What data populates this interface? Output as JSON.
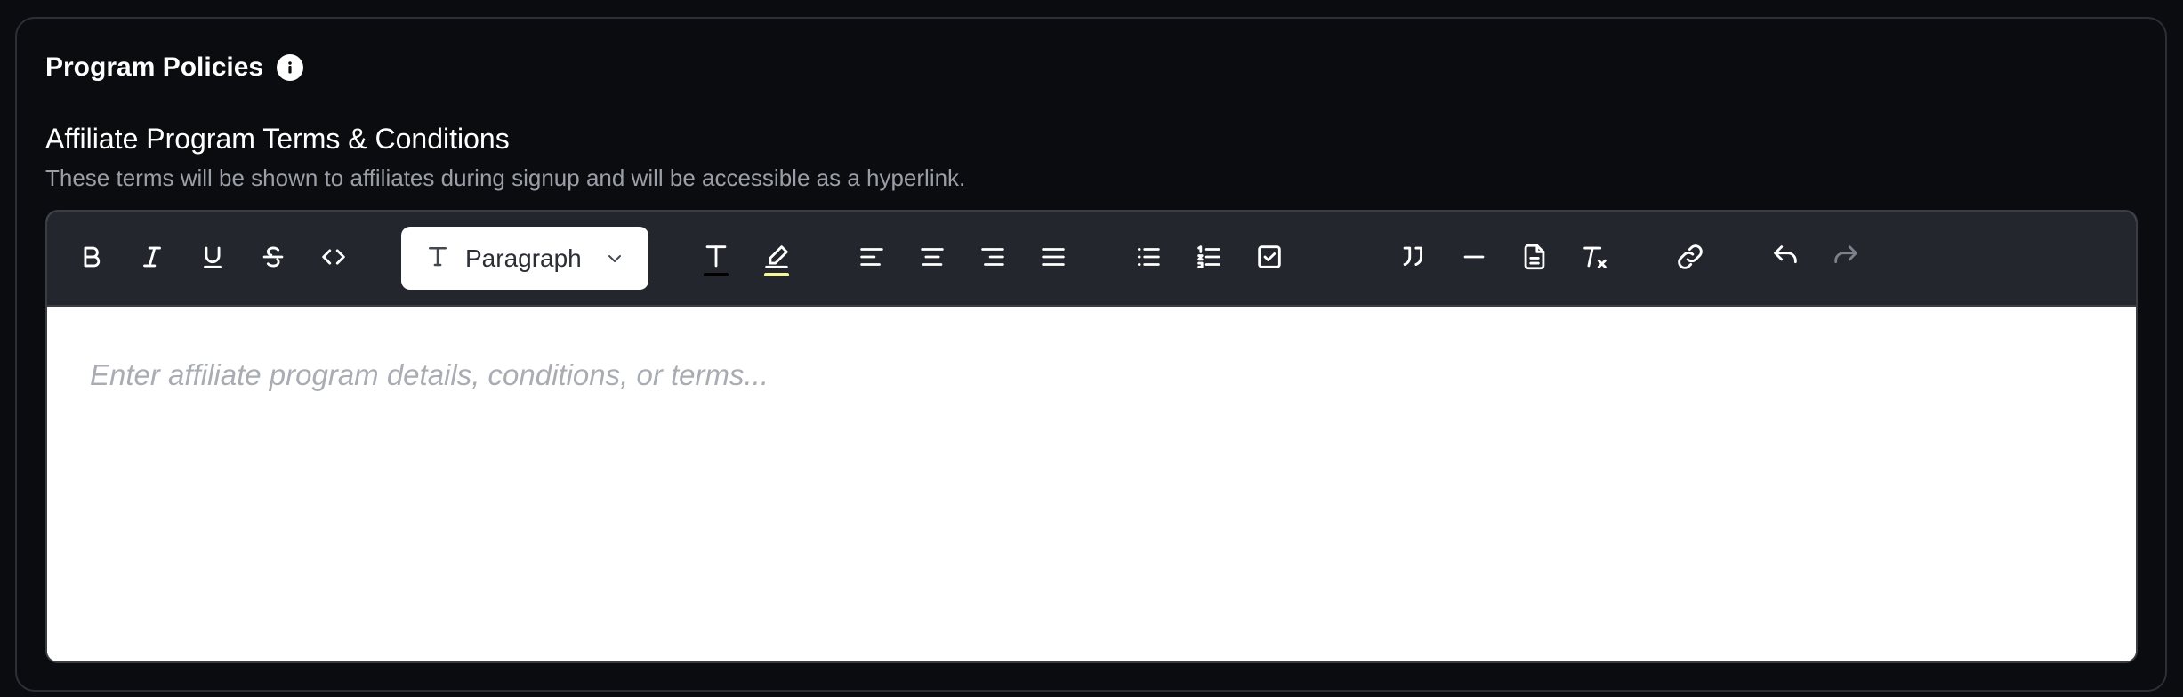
{
  "section": {
    "title": "Program Policies",
    "info_icon": "info-icon"
  },
  "field": {
    "label": "Affiliate Program Terms & Conditions",
    "description": "These terms will be shown to affiliates during signup and will be accessible as a hyperlink."
  },
  "toolbar": {
    "block_type": "Paragraph",
    "text_color": "#000000",
    "highlight_color": "#f5f5a0",
    "buttons": [
      "bold-icon",
      "italic-icon",
      "underline-icon",
      "strikethrough-icon",
      "code-icon",
      "text-color-icon",
      "highlight-icon",
      "align-left-icon",
      "align-center-icon",
      "align-right-icon",
      "align-justify-icon",
      "bullet-list-icon",
      "ordered-list-icon",
      "task-list-icon",
      "blockquote-icon",
      "horizontal-rule-icon",
      "document-icon",
      "clear-format-icon",
      "link-icon",
      "undo-icon",
      "redo-icon"
    ]
  },
  "editor": {
    "placeholder": "Enter affiliate program details, conditions, or terms..."
  }
}
